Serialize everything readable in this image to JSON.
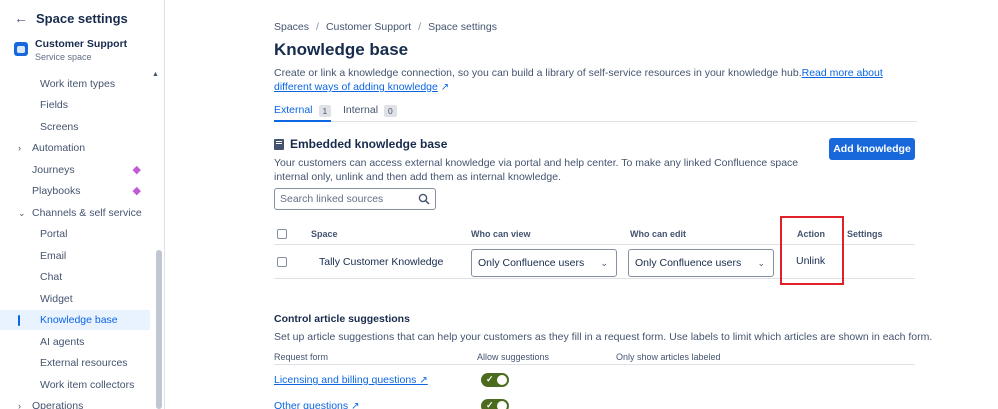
{
  "sidebar": {
    "title": "Space settings",
    "space_name": "Customer Support",
    "space_type": "Service space",
    "items": [
      {
        "label": "Work item types"
      },
      {
        "label": "Fields"
      },
      {
        "label": "Screens"
      },
      {
        "label": "Automation"
      },
      {
        "label": "Journeys"
      },
      {
        "label": "Playbooks"
      },
      {
        "label": "Channels & self service"
      },
      {
        "label": "Portal"
      },
      {
        "label": "Email"
      },
      {
        "label": "Chat"
      },
      {
        "label": "Widget"
      },
      {
        "label": "Knowledge base"
      },
      {
        "label": "AI agents"
      },
      {
        "label": "External resources"
      },
      {
        "label": "Work item collectors"
      },
      {
        "label": "Operations"
      }
    ]
  },
  "breadcrumb": [
    "Spaces",
    "Customer Support",
    "Space settings"
  ],
  "page": {
    "title": "Knowledge base",
    "description": "Create or link a knowledge connection, so you can build a library of self-service resources in your knowledge hub.",
    "description_link": "Read more about different ways of adding knowledge"
  },
  "tabs": [
    {
      "label": "External",
      "count": "1"
    },
    {
      "label": "Internal",
      "count": "0"
    }
  ],
  "embedded": {
    "title": "Embedded knowledge base",
    "add_button": "Add knowledge",
    "description": "Your customers can access external knowledge via portal and help center. To make any linked Confluence space internal only, unlink and then add them as internal knowledge.",
    "search_placeholder": "Search linked sources",
    "columns": [
      "Space",
      "Who can view",
      "Who can edit",
      "Action",
      "Settings"
    ],
    "rows": [
      {
        "space": "Tally Customer Knowledge",
        "view": "Only Confluence users",
        "edit": "Only Confluence users",
        "action": "Unlink"
      }
    ]
  },
  "suggestions": {
    "title": "Control article suggestions",
    "description": "Set up article suggestions that can help your customers as they fill in a request form. Use labels to limit which articles are shown in each form.",
    "columns": [
      "Request form",
      "Allow suggestions",
      "Only show articles labeled"
    ],
    "rows": [
      {
        "form": "Licensing and billing questions",
        "allowed": true
      },
      {
        "form": "Other questions",
        "allowed": true
      }
    ]
  },
  "colors": {
    "accent": "#1868db",
    "highlight": "#e2202a",
    "toggle_on": "#4c6b1f"
  }
}
